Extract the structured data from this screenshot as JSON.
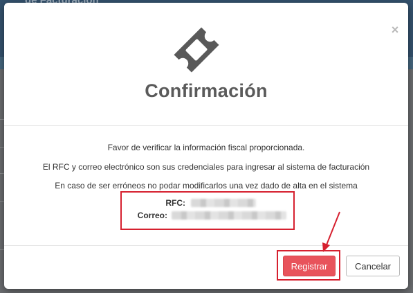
{
  "background": {
    "header_title": "de Facturación"
  },
  "modal": {
    "title": "Confirmación",
    "close_glyph": "×",
    "icon": "ticket-icon",
    "messages": [
      "Favor de verificar la información fiscal proporcionada.",
      "El RFC y correo electrónico son sus credenciales para ingresar al sistema de facturación",
      "En caso de ser erróneos no podar modificarlos una vez dado de alta en el sistema"
    ],
    "fields": {
      "rfc_label": "RFC:",
      "correo_label": "Correo:"
    },
    "buttons": {
      "register": "Registrar",
      "cancel": "Cancelar"
    }
  },
  "colors": {
    "primary": "#e8535b",
    "annotation": "#d6202f",
    "title": "#5a5a5a"
  }
}
